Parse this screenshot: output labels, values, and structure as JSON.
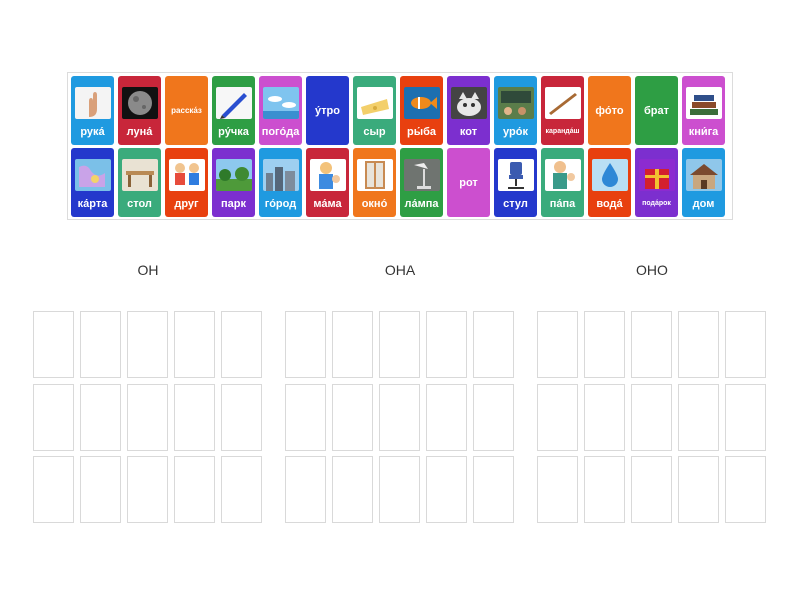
{
  "tray": {
    "cards": [
      {
        "label": "рука́",
        "color": "#1f9ae0",
        "icon": "hand-icon"
      },
      {
        "label": "луна́",
        "color": "#c8263a",
        "icon": "moon-icon"
      },
      {
        "label": "расска́з",
        "color": "#f0761c",
        "icon": "",
        "size": "small"
      },
      {
        "label": "ру́чка",
        "color": "#2e9e44",
        "icon": "pen-icon"
      },
      {
        "label": "пого́да",
        "color": "#cc4fcf",
        "icon": "weather-icon"
      },
      {
        "label": "у́тро",
        "color": "#2438cc",
        "icon": ""
      },
      {
        "label": "сыр",
        "color": "#3aab7c",
        "icon": "cheese-icon"
      },
      {
        "label": "ры́ба",
        "color": "#e8400f",
        "icon": "fish-icon"
      },
      {
        "label": "кот",
        "color": "#7c2fcf",
        "icon": "cat-icon"
      },
      {
        "label": "уро́к",
        "color": "#1f9ae0",
        "icon": "classroom-icon"
      },
      {
        "label": "каранда́ш",
        "color": "#c8263a",
        "icon": "pencil-icon",
        "size": "tiny"
      },
      {
        "label": "фо́то",
        "color": "#f0761c",
        "icon": ""
      },
      {
        "label": "брат",
        "color": "#2e9e44",
        "icon": ""
      },
      {
        "label": "кни́га",
        "color": "#cc4fcf",
        "icon": "books-icon"
      },
      {
        "label": "ка́рта",
        "color": "#2438cc",
        "icon": "map-icon"
      },
      {
        "label": "стол",
        "color": "#3aab7c",
        "icon": "table-icon"
      },
      {
        "label": "друг",
        "color": "#e8400f",
        "icon": "friends-icon"
      },
      {
        "label": "парк",
        "color": "#7c2fcf",
        "icon": "park-icon"
      },
      {
        "label": "го́род",
        "color": "#1f9ae0",
        "icon": "city-icon"
      },
      {
        "label": "ма́ма",
        "color": "#c8263a",
        "icon": "mother-icon"
      },
      {
        "label": "окно́",
        "color": "#f0761c",
        "icon": "window-icon"
      },
      {
        "label": "ла́мпа",
        "color": "#2e9e44",
        "icon": "lamp-icon"
      },
      {
        "label": "рот",
        "color": "#cc4fcf",
        "icon": ""
      },
      {
        "label": "стул",
        "color": "#2438cc",
        "icon": "chair-icon"
      },
      {
        "label": "па́па",
        "color": "#3aab7c",
        "icon": "father-icon"
      },
      {
        "label": "вода́",
        "color": "#e8400f",
        "icon": "water-icon"
      },
      {
        "label": "пода́рок",
        "color": "#7c2fcf",
        "icon": "gift-icon",
        "size": "tiny"
      },
      {
        "label": "дом",
        "color": "#1f9ae0",
        "icon": "house-icon"
      }
    ]
  },
  "groups": [
    {
      "heading": "ОН"
    },
    {
      "heading": "ОНА"
    },
    {
      "heading": "ОНО"
    }
  ]
}
